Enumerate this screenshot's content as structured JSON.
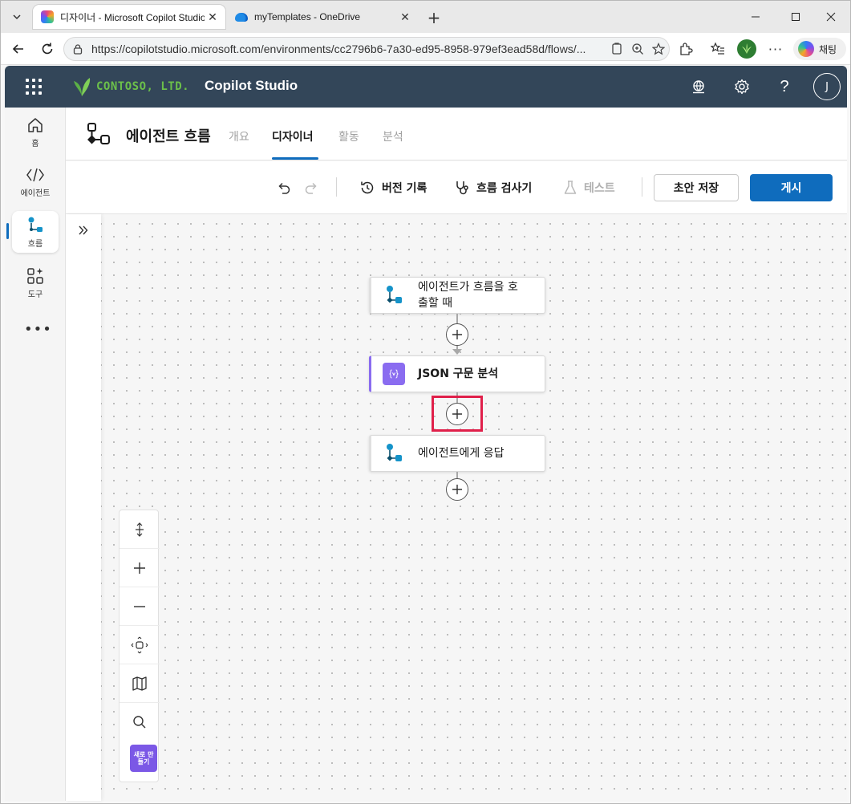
{
  "browser": {
    "tabs": [
      {
        "title": "디자이너 - Microsoft Copilot Studio",
        "active": true
      },
      {
        "title": "myTemplates - OneDrive",
        "active": false
      }
    ],
    "url": "https://copilotstudio.microsoft.com/environments/cc2796b6-7a30-ed95-8958-979ef3ead58d/flows/...",
    "chat_label": "채팅"
  },
  "app": {
    "brand": "CONTOSO, LTD.",
    "product": "Copilot Studio",
    "avatar_initial": "J",
    "accent": "#0f6cbd",
    "header_bg": "#334659"
  },
  "rail": {
    "items": [
      {
        "label": "홈",
        "icon": "home-icon"
      },
      {
        "label": "에이전트",
        "icon": "agent-icon"
      },
      {
        "label": "흐름",
        "icon": "flow-icon",
        "active": true
      },
      {
        "label": "도구",
        "icon": "tools-icon"
      }
    ],
    "more": "•••"
  },
  "page": {
    "title": "에이전트 흐름",
    "tabs": [
      {
        "label": "개요"
      },
      {
        "label": "디자이너",
        "active": true
      },
      {
        "label": "활동"
      },
      {
        "label": "분석"
      }
    ]
  },
  "toolbar": {
    "version_history": "버전 기록",
    "flow_checker": "흐름 검사기",
    "test": "테스트",
    "save_draft": "초안 저장",
    "publish": "게시"
  },
  "flow": {
    "nodes": [
      {
        "label_line1": "에이전트가 흐름을 호",
        "label_line2": "출할 때",
        "icon": "flow-trigger-icon"
      },
      {
        "label": "JSON 구문 분석",
        "icon": "json-parse-icon"
      },
      {
        "label": "에이전트에게 응답",
        "icon": "flow-trigger-icon"
      }
    ]
  },
  "canvas_controls": {
    "new_label": "새로 만들기"
  }
}
